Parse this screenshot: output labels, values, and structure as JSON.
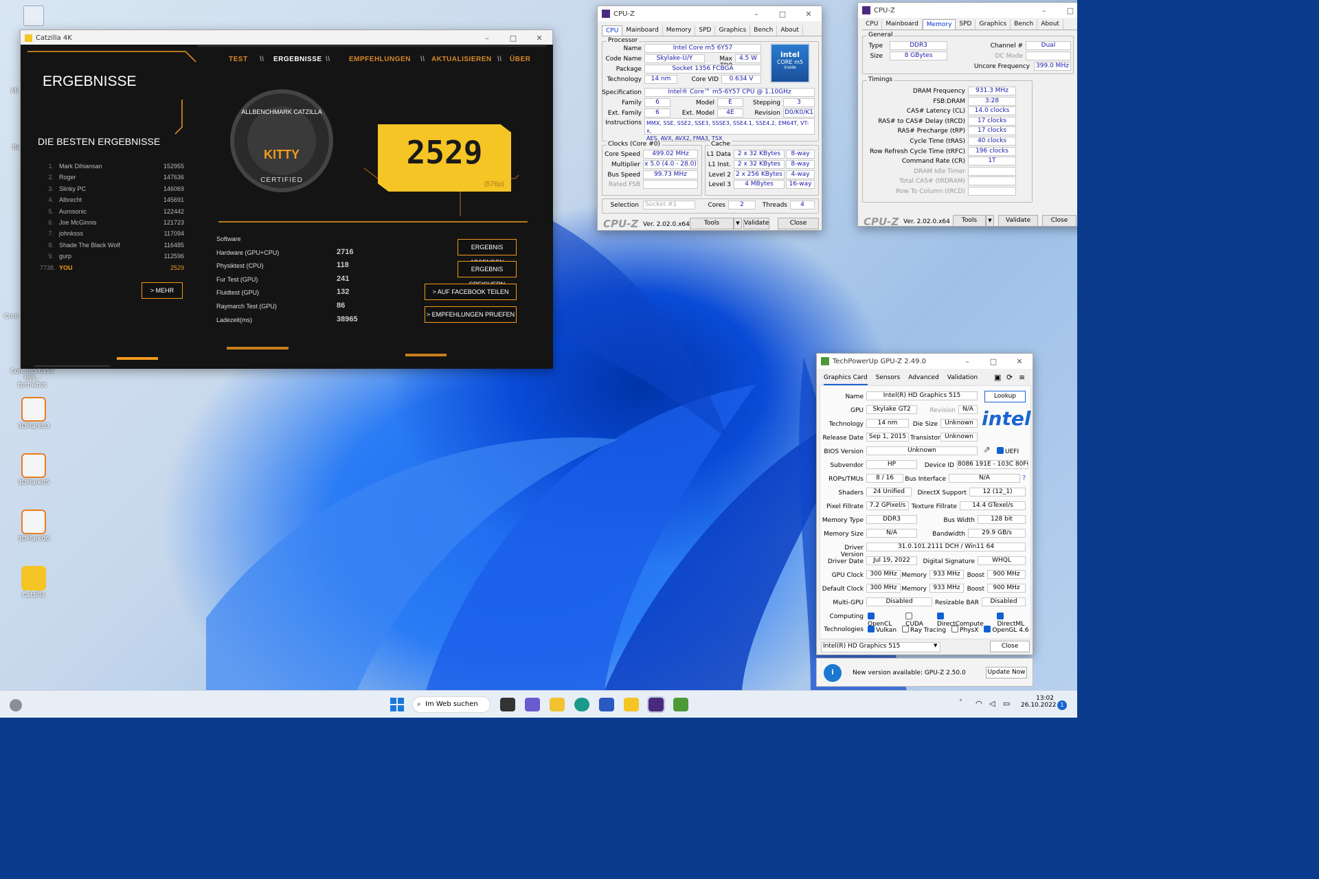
{
  "desktop": {
    "icons": [
      {
        "label": "3DMark03"
      },
      {
        "label": "3DMark05"
      },
      {
        "label": "3DMark06"
      },
      {
        "label": "Catzilla"
      }
    ],
    "partial_labels": {
      "core_label": "Core m5 6Y57 HW...",
      "core_label2": "fpshwbot",
      "mi": "Mi",
      "be": "Be",
      "core_small": "Core"
    }
  },
  "catzilla": {
    "title": "Catzilla 4K",
    "nav": [
      "TEST",
      "ERGEBNISSE",
      "EMPFEHLUNGEN",
      "AKTUALISIEREN",
      "ÜBER"
    ],
    "nav_sep": "\\\\",
    "heading": "ERGEBNISSE",
    "best_heading": "DIE BESTEN ERGEBNISSE",
    "badge_top": "ALLBENCHMARK CATZILLA",
    "badge_mid": "KITTY",
    "badge_bottom": "CERTIFIED",
    "score": "2529",
    "score_res": "(576p)",
    "leaderboard": [
      {
        "n": "1.",
        "name": "Mark Dihiansan",
        "score": "152955"
      },
      {
        "n": "2.",
        "name": "Roger",
        "score": "147636"
      },
      {
        "n": "3.",
        "name": "Slinky PC",
        "score": "146069"
      },
      {
        "n": "4.",
        "name": "Albrecht",
        "score": "145691"
      },
      {
        "n": "5.",
        "name": "Aurosonic",
        "score": "122442"
      },
      {
        "n": "6.",
        "name": "Joe McGinnis",
        "score": "121723"
      },
      {
        "n": "7.",
        "name": "johnksss",
        "score": "117094"
      },
      {
        "n": "8.",
        "name": "Shade The Black Wolf",
        "score": "116485"
      },
      {
        "n": "9.",
        "name": "gurp",
        "score": "112596"
      },
      {
        "n": "7738.",
        "name": "YOU",
        "score": "2529"
      }
    ],
    "more": "> MEHR",
    "details": [
      {
        "label": "Software",
        "value": ""
      },
      {
        "label": "Hardware (GPU+CPU)",
        "value": "2716"
      },
      {
        "label": "Physiktest (CPU)",
        "value": "118"
      },
      {
        "label": "Fur Test (GPU)",
        "value": "241"
      },
      {
        "label": "Fluidtest (GPU)",
        "value": "132"
      },
      {
        "label": "Raymarch Test (GPU)",
        "value": "86"
      },
      {
        "label": "Ladezeit(ms)",
        "value": "38965"
      }
    ],
    "buttons": {
      "send": "ERGEBNIS ABSENDEN",
      "save": "ERGEBNIS SPEICHERN",
      "facebook": "> AUF FACEBOOK TEILEN",
      "recommend": "> EMPFEHLUNGEN PRUEFEN"
    },
    "colors": {
      "accent": "#f29a1e",
      "score_bg": "#f5c526"
    }
  },
  "cpuz1": {
    "title": "CPU-Z",
    "tabs": [
      "CPU",
      "Mainboard",
      "Memory",
      "SPD",
      "Graphics",
      "Bench",
      "About"
    ],
    "processor_group": "Processor",
    "name_l": "Name",
    "name": "Intel Core m5 6Y57",
    "code_l": "Code Name",
    "code": "Skylake-U/Y",
    "tdp_l": "Max TDP",
    "tdp": "4.5 W",
    "pkg_l": "Package",
    "pkg": "Socket 1356 FCBGA",
    "tech_l": "Technology",
    "tech": "14 nm",
    "vid_l": "Core VID",
    "vid": "0.634 V",
    "spec_l": "Specification",
    "spec": "Intel® Core™ m5-6Y57 CPU @ 1.10GHz",
    "family_l": "Family",
    "family": "6",
    "model_l": "Model",
    "model": "E",
    "step_l": "Stepping",
    "step": "3",
    "extfam_l": "Ext. Family",
    "extfam": "6",
    "extmod_l": "Ext. Model",
    "extmod": "4E",
    "rev_l": "Revision",
    "rev": "D0/K0/K1",
    "inst_l": "Instructions",
    "inst1": "MMX, SSE, SSE2, SSE3, SSSE3, SSE4.1, SSE4.2, EM64T, VT-x,",
    "inst2": "AES, AVX, AVX2, FMA3, TSX",
    "clocks_group": "Clocks (Core #0)",
    "cs_l": "Core Speed",
    "cs": "499.02 MHz",
    "mult_l": "Multiplier",
    "mult": "x 5.0 (4.0 - 28.0)",
    "bus_l": "Bus Speed",
    "bus": "99.73 MHz",
    "fsb_l": "Rated FSB",
    "cache_group": "Cache",
    "l1d_l": "L1 Data",
    "l1d": "2 x 32 KBytes",
    "l1d_w": "8-way",
    "l1i_l": "L1 Inst.",
    "l1i": "2 x 32 KBytes",
    "l1i_w": "8-way",
    "l2_l": "Level 2",
    "l2": "2 x 256 KBytes",
    "l2_w": "4-way",
    "l3_l": "Level 3",
    "l3": "4 MBytes",
    "l3_w": "16-way",
    "sel_l": "Selection",
    "sel": "Socket #1",
    "cores_l": "Cores",
    "cores": "2",
    "threads_l": "Threads",
    "threads": "4",
    "intel_inside_1": "intel",
    "intel_inside_2": "CORE m5",
    "intel_inside_3": "inside",
    "logo": "CPU-Z",
    "ver": "Ver. 2.02.0.x64",
    "tools": "Tools",
    "validate": "Validate",
    "close": "Close"
  },
  "cpuz2": {
    "title": "CPU-Z",
    "tabs": [
      "CPU",
      "Mainboard",
      "Memory",
      "SPD",
      "Graphics",
      "Bench",
      "About"
    ],
    "general_group": "General",
    "type_l": "Type",
    "type": "DDR3",
    "size_l": "Size",
    "size": "8 GBytes",
    "chan_l": "Channel #",
    "chan": "Dual",
    "dcm_l": "DC Mode",
    "unc_l": "Uncore Frequency",
    "unc": "399.0 MHz",
    "timings_group": "Timings",
    "timings": [
      {
        "l": "DRAM Frequency",
        "v": "931.3 MHz",
        "dis": false
      },
      {
        "l": "FSB:DRAM",
        "v": "3:28",
        "dis": false
      },
      {
        "l": "CAS# Latency (CL)",
        "v": "14.0 clocks",
        "dis": false
      },
      {
        "l": "RAS# to CAS# Delay (tRCD)",
        "v": "17 clocks",
        "dis": false
      },
      {
        "l": "RAS# Precharge (tRP)",
        "v": "17 clocks",
        "dis": false
      },
      {
        "l": "Cycle Time (tRAS)",
        "v": "40 clocks",
        "dis": false
      },
      {
        "l": "Row Refresh Cycle Time (tRFC)",
        "v": "196 clocks",
        "dis": false
      },
      {
        "l": "Command Rate (CR)",
        "v": "1T",
        "dis": false
      },
      {
        "l": "DRAM Idle Timer",
        "v": "",
        "dis": true
      },
      {
        "l": "Total CAS# (tRDRAM)",
        "v": "",
        "dis": true
      },
      {
        "l": "Row To Column (tRCD)",
        "v": "",
        "dis": true
      }
    ],
    "logo": "CPU-Z",
    "ver": "Ver. 2.02.0.x64",
    "tools": "Tools",
    "validate": "Validate",
    "close": "Close"
  },
  "gpuz": {
    "title": "TechPowerUp GPU-Z 2.49.0",
    "tabs": [
      "Graphics Card",
      "Sensors",
      "Advanced",
      "Validation"
    ],
    "name_l": "Name",
    "name": "Intel(R) HD Graphics 515",
    "lookup": "Lookup",
    "gpu_l": "GPU",
    "gpu": "Skylake GT2",
    "rev_l": "Revision",
    "rev": "N/A",
    "tech_l": "Technology",
    "tech": "14 nm",
    "die_l": "Die Size",
    "die": "Unknown",
    "rel_l": "Release Date",
    "rel": "Sep 1, 2015",
    "trans_l": "Transistors",
    "trans": "Unknown",
    "bios_l": "BIOS Version",
    "bios": "Unknown",
    "uefi": "UEFI",
    "subv_l": "Subvendor",
    "subv": "HP",
    "devid_l": "Device ID",
    "devid": "8086 191E - 103C 80FC",
    "rops_l": "ROPs/TMUs",
    "rops": "8 / 16",
    "busif_l": "Bus Interface",
    "busif": "N/A",
    "q": "?",
    "shaders_l": "Shaders",
    "shaders": "24 Unified",
    "dx_l": "DirectX Support",
    "dx": "12 (12_1)",
    "pix_l": "Pixel Fillrate",
    "pix": "7.2 GPixel/s",
    "tex_l": "Texture Fillrate",
    "tex": "14.4 GTexel/s",
    "memt_l": "Memory Type",
    "memt": "DDR3",
    "bw_l": "Bus Width",
    "bw": "128 bit",
    "mems_l": "Memory Size",
    "mems": "N/A",
    "band_l": "Bandwidth",
    "band": "29.9 GB/s",
    "drv_l": "Driver Version",
    "drv": "31.0.101.2111 DCH / Win11 64",
    "drvd_l": "Driver Date",
    "drvd": "Jul 19, 2022",
    "dsig_l": "Digital Signature",
    "dsig": "WHQL",
    "gclk_l": "GPU Clock",
    "gclk": "300 MHz",
    "mem_l": "Memory",
    "gmem": "933 MHz",
    "boost_l": "Boost",
    "gboost": "900 MHz",
    "dclk_l": "Default Clock",
    "dclk": "300 MHz",
    "dmem": "933 MHz",
    "dboost": "900 MHz",
    "multi_l": "Multi-GPU",
    "multi": "Disabled",
    "rbar_l": "Resizable BAR",
    "rbar": "Disabled",
    "comp_l": "Computing",
    "techs_l": "Technologies",
    "computing": [
      {
        "l": "OpenCL",
        "on": true
      },
      {
        "l": "CUDA",
        "on": false
      },
      {
        "l": "DirectCompute",
        "on": true
      },
      {
        "l": "DirectML",
        "on": true
      }
    ],
    "technologies": [
      {
        "l": "Vulkan",
        "on": true
      },
      {
        "l": "Ray Tracing",
        "on": false
      },
      {
        "l": "PhysX",
        "on": false
      },
      {
        "l": "OpenGL 4.6",
        "on": true
      }
    ],
    "select": "Intel(R) HD Graphics 515",
    "close": "Close",
    "intel_logo": "intel"
  },
  "notify": {
    "text": "New version available: GPU-Z 2.50.0",
    "button": "Update Now",
    "icon": "i"
  },
  "taskbar": {
    "search": "Im Web suchen",
    "time": "13:02",
    "date": "26.10.2022",
    "badge": "1"
  }
}
